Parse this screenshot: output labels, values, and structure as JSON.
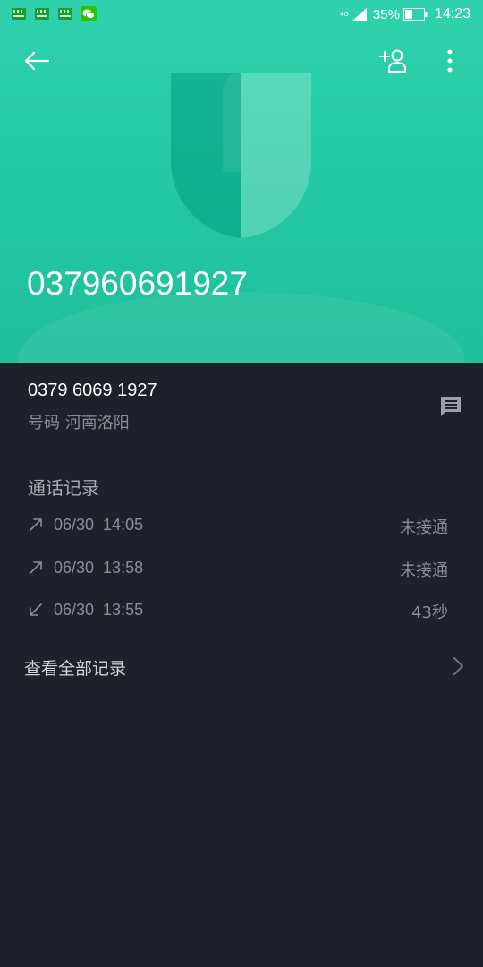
{
  "status_bar": {
    "left_icons": [
      "sim-card-icon",
      "sim-card-icon",
      "sim-card-icon",
      "wechat-icon"
    ],
    "network_type": "4G",
    "battery": "35%",
    "time": "14:23"
  },
  "header": {
    "background_color": "#23c7a3",
    "contact_name": "037960691927",
    "back_icon": "arrow-left-icon",
    "add_contact_icon": "add-person-icon",
    "more_icon": "more-vertical-icon"
  },
  "number_info": {
    "number": "0379 6069 1927",
    "location": "号码 河南洛阳",
    "message_icon": "message-icon"
  },
  "call_log": {
    "title": "通话记录",
    "entries": [
      {
        "direction": "outgoing",
        "icon": "outgoing-call-icon",
        "date": "06/30  14:05",
        "status": "未接通"
      },
      {
        "direction": "outgoing",
        "icon": "outgoing-call-icon",
        "date": "06/30  13:58",
        "status": "未接通"
      },
      {
        "direction": "incoming",
        "icon": "incoming-call-icon",
        "date": "06/30  13:55",
        "status": "43秒"
      }
    ],
    "view_all_label": "查看全部记录"
  },
  "colors": {
    "accent": "#23c7a3",
    "background": "#1e2129",
    "secondary_text": "#8a8e97"
  }
}
